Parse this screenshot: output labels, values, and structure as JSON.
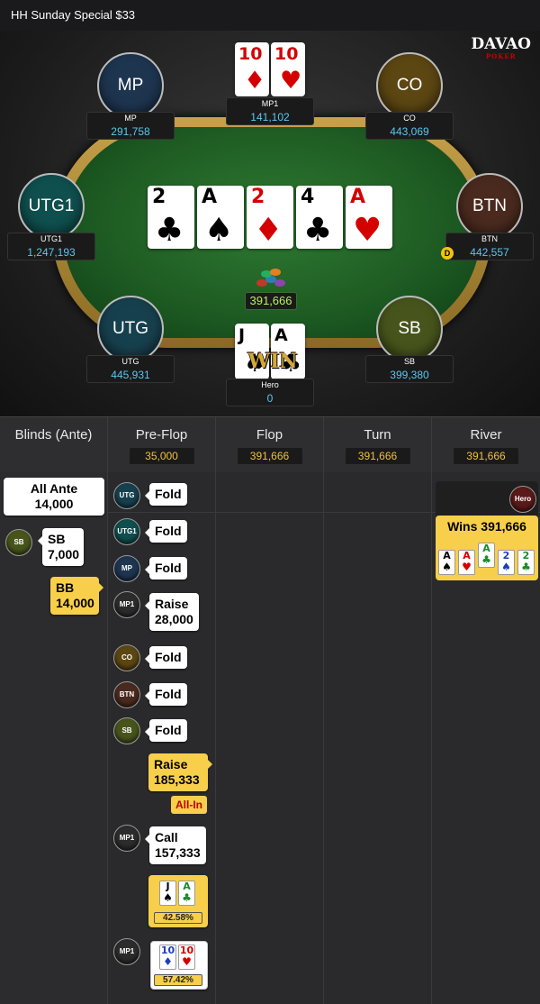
{
  "title": "HH  Sunday Special $33",
  "logo": {
    "text": "DAVAO",
    "sub": "POKER"
  },
  "table": {
    "seats": [
      {
        "id": "MP",
        "disc": "MP",
        "name": "MP",
        "stack": "291,758",
        "color": "#1e3550"
      },
      {
        "id": "CO",
        "disc": "CO",
        "name": "CO",
        "stack": "443,069",
        "color": "#5c4612"
      },
      {
        "id": "UTG1",
        "disc": "UTG1",
        "name": "UTG1",
        "stack": "1,247,193",
        "color": "#0f4f4e"
      },
      {
        "id": "BTN",
        "disc": "BTN",
        "name": "BTN",
        "stack": "442,557",
        "color": "#4a2a1e"
      },
      {
        "id": "UTG",
        "disc": "UTG",
        "name": "UTG",
        "stack": "445,931",
        "color": "#17404e"
      },
      {
        "id": "SB",
        "disc": "SB",
        "name": "SB",
        "stack": "399,380",
        "color": "#47551c"
      },
      {
        "id": "MP1",
        "name": "MP1",
        "stack": "141,102"
      },
      {
        "id": "Hero",
        "name": "Hero",
        "stack": "0"
      }
    ],
    "dealer": "D",
    "pot": "391,666",
    "win_label": "WIN",
    "board": [
      {
        "rank": "2",
        "suit": "♣",
        "color": "black"
      },
      {
        "rank": "A",
        "suit": "♠",
        "color": "black"
      },
      {
        "rank": "2",
        "suit": "♦",
        "color": "red"
      },
      {
        "rank": "4",
        "suit": "♣",
        "color": "black"
      },
      {
        "rank": "A",
        "suit": "♥",
        "color": "red"
      }
    ],
    "mp1_cards": [
      {
        "rank": "10",
        "suit": "♦",
        "color": "red"
      },
      {
        "rank": "10",
        "suit": "♥",
        "color": "red"
      }
    ],
    "hero_cards": [
      {
        "rank": "J",
        "suit": "♠",
        "color": "black"
      },
      {
        "rank": "A",
        "suit": "♣",
        "color": "black"
      }
    ]
  },
  "streets": [
    {
      "name": "Blinds (Ante)",
      "pot": ""
    },
    {
      "name": "Pre-Flop",
      "pot": "35,000"
    },
    {
      "name": "Flop",
      "pot": "391,666"
    },
    {
      "name": "Turn",
      "pot": "391,666"
    },
    {
      "name": "River",
      "pot": "391,666"
    }
  ],
  "blinds": {
    "ante_label": "All Ante",
    "ante_value": "14,000",
    "sb_chip": "SB",
    "sb_label": "SB",
    "sb_value": "7,000",
    "bb_label": "BB",
    "bb_value": "14,000"
  },
  "preflop": [
    {
      "chip": "UTG",
      "action": "Fold"
    },
    {
      "chip": "UTG1",
      "action": "Fold"
    },
    {
      "chip": "MP",
      "action": "Fold"
    },
    {
      "chip": "MP1",
      "action": "Raise",
      "amount": "28,000"
    },
    {
      "chip": "CO",
      "action": "Fold"
    },
    {
      "chip": "BTN",
      "action": "Fold"
    },
    {
      "chip": "SB",
      "action": "Fold"
    },
    {
      "chip": "",
      "action": "Raise",
      "amount": "185,333"
    },
    {
      "chip": "MP1",
      "action": "Call",
      "amount": "157,333"
    }
  ],
  "allin_label": "All-In",
  "hero_equity": {
    "cards": [
      {
        "rank": "J",
        "suit": "♠",
        "color": "black"
      },
      {
        "rank": "A",
        "suit": "♣",
        "color": "green"
      }
    ],
    "pct": "42.58%"
  },
  "mp1_equity": {
    "chip": "MP1",
    "cards": [
      {
        "rank": "10",
        "suit": "♦",
        "color": "blue"
      },
      {
        "rank": "10",
        "suit": "♥",
        "color": "red"
      }
    ],
    "pct": "57.42%"
  },
  "river": {
    "chip": "Hero",
    "wins": "Wins 391,666",
    "hand": [
      {
        "rank": "A",
        "suit": "♠",
        "color": "black"
      },
      {
        "rank": "A",
        "suit": "♥",
        "color": "red"
      },
      {
        "rank": "A",
        "suit": "♣",
        "color": "green"
      },
      {
        "rank": "2",
        "suit": "♠",
        "color": "blue"
      },
      {
        "rank": "2",
        "suit": "♣",
        "color": "green"
      }
    ]
  }
}
